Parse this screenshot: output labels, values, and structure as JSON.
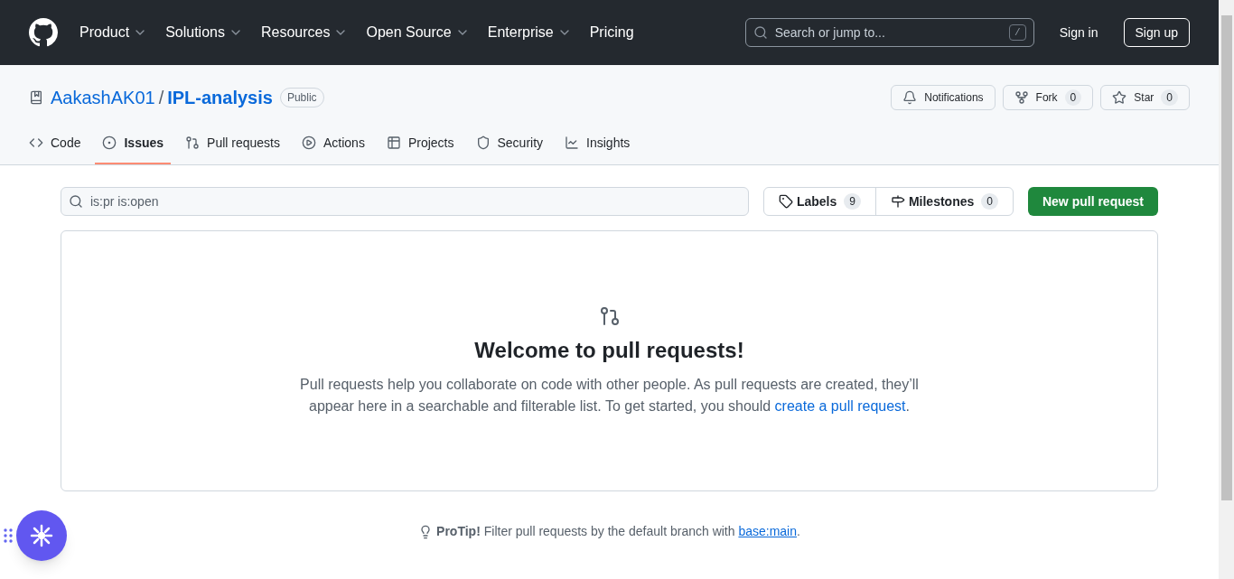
{
  "header": {
    "nav": [
      {
        "label": "Product",
        "dropdown": true
      },
      {
        "label": "Solutions",
        "dropdown": true
      },
      {
        "label": "Resources",
        "dropdown": true
      },
      {
        "label": "Open Source",
        "dropdown": true
      },
      {
        "label": "Enterprise",
        "dropdown": true
      },
      {
        "label": "Pricing",
        "dropdown": false
      }
    ],
    "search": {
      "placeholder": "Search or jump to...",
      "shortcut": "/"
    },
    "sign_in": "Sign in",
    "sign_up": "Sign up"
  },
  "repo": {
    "owner": "AakashAK01",
    "separator": "/",
    "name": "IPL-analysis",
    "visibility": "Public",
    "actions": [
      {
        "kind": "bell",
        "label": "Notifications"
      },
      {
        "kind": "fork",
        "label": "Fork",
        "count": "0"
      },
      {
        "kind": "star",
        "label": "Star",
        "count": "0"
      }
    ]
  },
  "tabs": [
    {
      "kind": "code",
      "label": "Code",
      "selected": false
    },
    {
      "kind": "issues",
      "label": "Issues",
      "selected": true
    },
    {
      "kind": "pulls",
      "label": "Pull requests",
      "selected": false
    },
    {
      "kind": "actions",
      "label": "Actions",
      "selected": false
    },
    {
      "kind": "projects",
      "label": "Projects",
      "selected": false
    },
    {
      "kind": "security",
      "label": "Security",
      "selected": false
    },
    {
      "kind": "insights",
      "label": "Insights",
      "selected": false
    }
  ],
  "filter": {
    "value": "is:pr is:open"
  },
  "labels": {
    "label": "Labels",
    "count": "9"
  },
  "milestones": {
    "label": "Milestones",
    "count": "0"
  },
  "new_button": "New pull request",
  "blankslate": {
    "title": "Welcome to pull requests!",
    "text_before": "Pull requests help you collaborate on code with other people. As pull requests are created, they’ll appear here in a searchable and filterable list. To get started, you should ",
    "link": "create a pull request",
    "text_after": "."
  },
  "protip": {
    "text": "**ProTip!** Filter pull requests by the default branch with ",
    "link": "base:main",
    "text_after": "."
  }
}
